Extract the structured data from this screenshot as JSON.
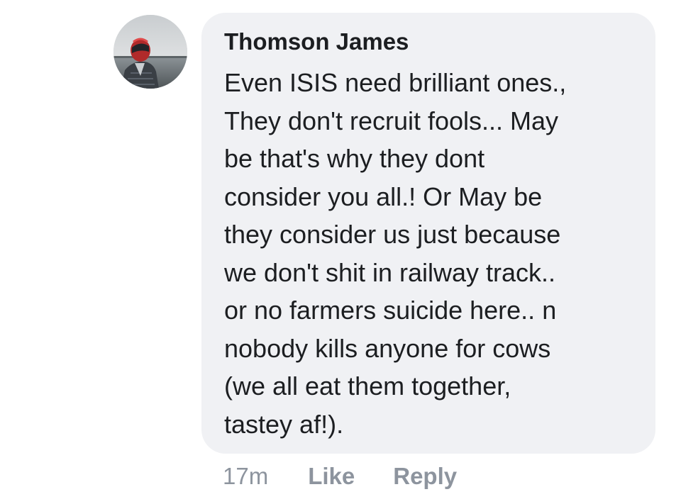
{
  "comment": {
    "author": "Thomson James",
    "body_lines": [
      "Even ISIS need brilliant ones.,",
      "They don't recruit fools... May",
      "be that's why they dont",
      "consider you all.! Or May be",
      "they consider us just because",
      "we don't shit in railway track..",
      "or no farmers suicide here.. n",
      "nobody kills anyone for cows",
      "(we all eat them together,",
      "tastey af!)."
    ],
    "avatar_icon": "profile-photo-helmet",
    "timestamp": "17m",
    "like_label": "Like",
    "reply_label": "Reply"
  },
  "colors": {
    "bubble_background": "#f0f1f4",
    "text": "#1c1e21",
    "meta_text": "#8d949e"
  }
}
